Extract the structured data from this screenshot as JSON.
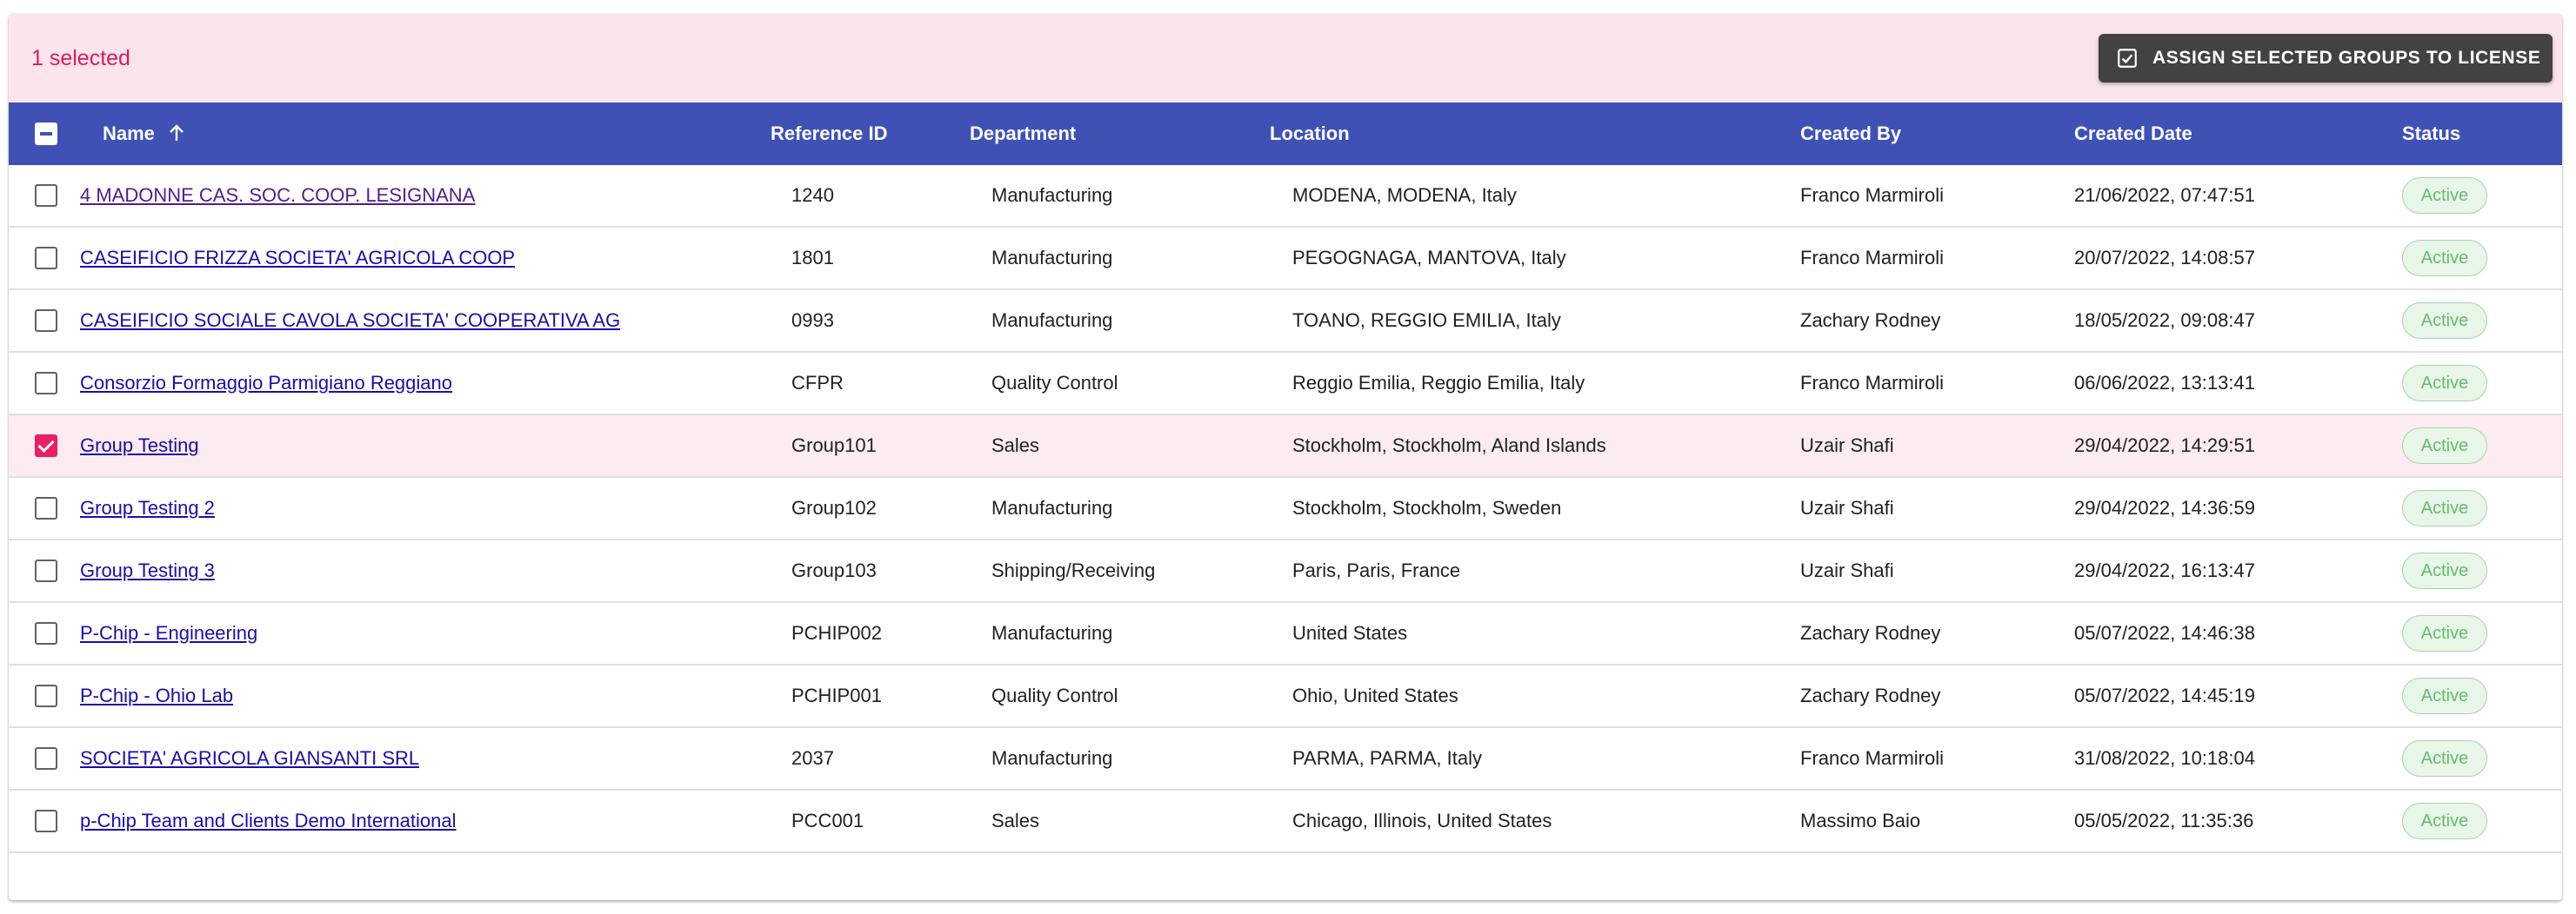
{
  "toolbar": {
    "selected_text": "1 selected",
    "assign_label": "ASSIGN SELECTED GROUPS TO LICENSE",
    "assign_icon": "checkbox-icon"
  },
  "columns": [
    {
      "key": "name",
      "label": "Name",
      "sort": "ascending"
    },
    {
      "key": "ref",
      "label": "Reference ID"
    },
    {
      "key": "dept",
      "label": "Department"
    },
    {
      "key": "loc",
      "label": "Location"
    },
    {
      "key": "by",
      "label": "Created By"
    },
    {
      "key": "date",
      "label": "Created Date"
    },
    {
      "key": "status",
      "label": "Status"
    }
  ],
  "colors": {
    "header_bg": "#3f51b5",
    "toolbar_bg": "#fbe4ec",
    "selected_accent": "#e91e63",
    "status_active": "#66bb6a"
  },
  "rows": [
    {
      "name": "4 MADONNE CAS. SOC. COOP. LESIGNANA",
      "ref": "1240",
      "dept": "Manufacturing",
      "loc": "MODENA, MODENA, Italy",
      "by": "Franco Marmiroli",
      "date": "21/06/2022, 07:47:51",
      "status": "Active",
      "selected": false,
      "visited": true
    },
    {
      "name": "CASEIFICIO FRIZZA SOCIETA' AGRICOLA COOP",
      "ref": "1801",
      "dept": "Manufacturing",
      "loc": "PEGOGNAGA, MANTOVA, Italy",
      "by": "Franco Marmiroli",
      "date": "20/07/2022, 14:08:57",
      "status": "Active",
      "selected": false,
      "visited": false
    },
    {
      "name": "CASEIFICIO SOCIALE CAVOLA SOCIETA' COOPERATIVA AG",
      "ref": "0993",
      "dept": "Manufacturing",
      "loc": "TOANO, REGGIO EMILIA, Italy",
      "by": "Zachary Rodney",
      "date": "18/05/2022, 09:08:47",
      "status": "Active",
      "selected": false,
      "visited": false
    },
    {
      "name": "Consorzio Formaggio Parmigiano Reggiano",
      "ref": "CFPR",
      "dept": "Quality Control",
      "loc": "Reggio Emilia, Reggio Emilia, Italy",
      "by": "Franco Marmiroli",
      "date": "06/06/2022, 13:13:41",
      "status": "Active",
      "selected": false,
      "visited": false
    },
    {
      "name": "Group Testing",
      "ref": "Group101",
      "dept": "Sales",
      "loc": "Stockholm, Stockholm, Aland Islands",
      "by": "Uzair Shafi",
      "date": "29/04/2022, 14:29:51",
      "status": "Active",
      "selected": true,
      "visited": false
    },
    {
      "name": "Group Testing 2",
      "ref": "Group102",
      "dept": "Manufacturing",
      "loc": "Stockholm, Stockholm, Sweden",
      "by": "Uzair Shafi",
      "date": "29/04/2022, 14:36:59",
      "status": "Active",
      "selected": false,
      "visited": false
    },
    {
      "name": "Group Testing 3",
      "ref": "Group103",
      "dept": "Shipping/Receiving",
      "loc": "Paris, Paris, France",
      "by": "Uzair Shafi",
      "date": "29/04/2022, 16:13:47",
      "status": "Active",
      "selected": false,
      "visited": false
    },
    {
      "name": "P-Chip - Engineering",
      "ref": "PCHIP002",
      "dept": "Manufacturing",
      "loc": "United States",
      "by": "Zachary Rodney",
      "date": "05/07/2022, 14:46:38",
      "status": "Active",
      "selected": false,
      "visited": false
    },
    {
      "name": "P-Chip - Ohio Lab",
      "ref": "PCHIP001",
      "dept": "Quality Control",
      "loc": "Ohio, United States",
      "by": "Zachary Rodney",
      "date": "05/07/2022, 14:45:19",
      "status": "Active",
      "selected": false,
      "visited": false
    },
    {
      "name": "SOCIETA' AGRICOLA GIANSANTI SRL",
      "ref": "2037",
      "dept": "Manufacturing",
      "loc": "PARMA, PARMA, Italy",
      "by": "Franco Marmiroli",
      "date": "31/08/2022, 10:18:04",
      "status": "Active",
      "selected": false,
      "visited": false
    },
    {
      "name": "p-Chip Team and Clients Demo International",
      "ref": "PCC001",
      "dept": "Sales",
      "loc": "Chicago, Illinois, United States",
      "by": "Massimo Baio",
      "date": "05/05/2022, 11:35:36",
      "status": "Active",
      "selected": false,
      "visited": false
    }
  ]
}
